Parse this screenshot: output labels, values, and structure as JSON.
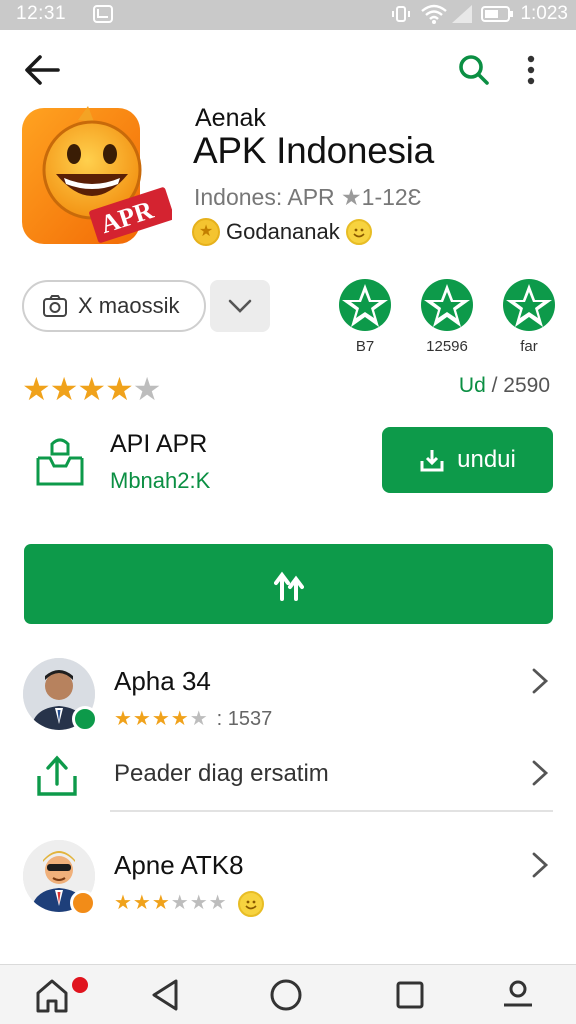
{
  "status_bar": {
    "time_left": "12:31",
    "time_right": "1:023"
  },
  "app": {
    "subtitle": "Aenak",
    "title": "APK Indonesia",
    "meta": "Indones: APR",
    "meta_rating": "1-12Ԑ",
    "developer": "Godananak",
    "icon_label": "APR"
  },
  "filter": {
    "chip_label": "X maossik"
  },
  "badges": [
    {
      "label": "B7"
    },
    {
      "label": "12596"
    },
    {
      "label": "far"
    }
  ],
  "rating": {
    "stars": 4.5,
    "green": "Ud",
    "text": "/ 2590"
  },
  "apk_row": {
    "title": "API APR",
    "subtitle": "Mbnah2:K",
    "button_label": "undui"
  },
  "reviews": [
    {
      "name": "Apha 34",
      "stars": 4,
      "count": ": 1537"
    },
    {
      "name": "Apne ATK8",
      "stars": 3,
      "count": ""
    }
  ],
  "share_row": {
    "label": "Peader diag ersatim"
  },
  "colors": {
    "primary": "#0d9a4a",
    "star": "#f0a21b",
    "status_bar": "#c9c9c9"
  }
}
